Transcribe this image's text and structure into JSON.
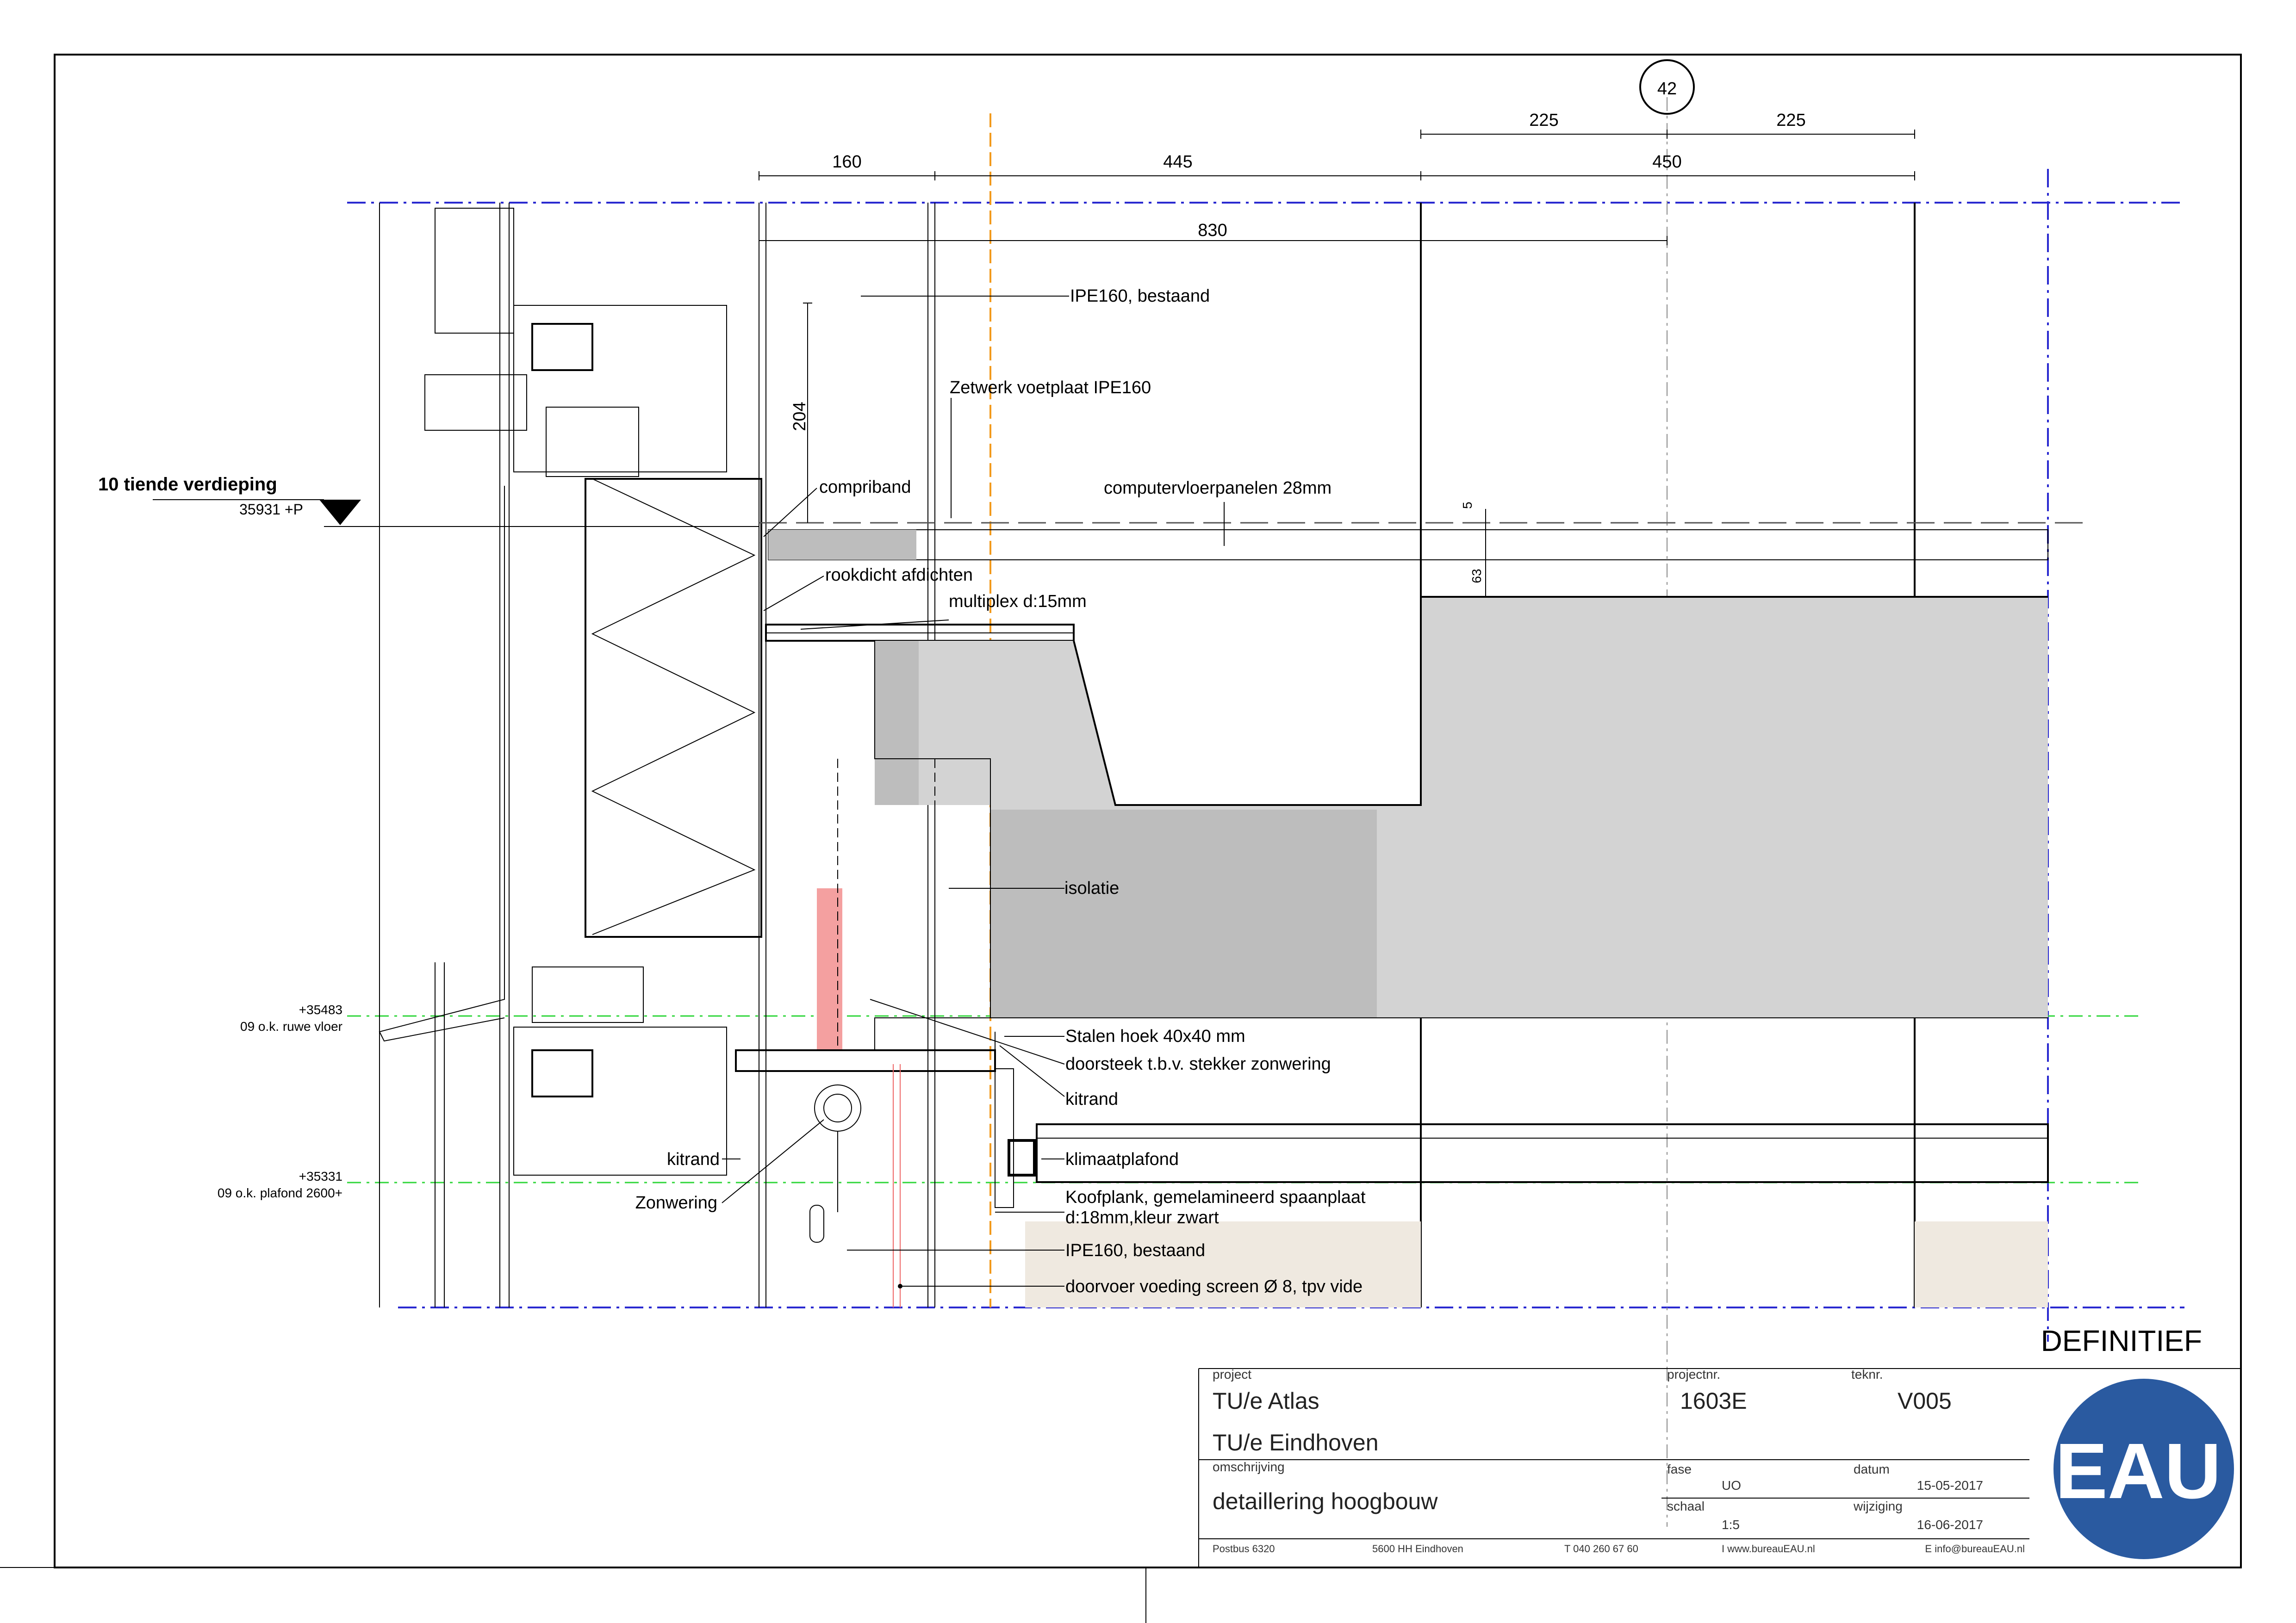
{
  "grid_marker": "42",
  "dimensions": {
    "d160": "160",
    "d445": "445",
    "d450": "450",
    "d225a": "225",
    "d225b": "225",
    "d830": "830",
    "d204": "204",
    "d5": "5",
    "d63": "63"
  },
  "levels": {
    "floor10_name": "10 tiende verdieping",
    "floor10_value": "35931 +P",
    "rough_floor_value": "+35483",
    "rough_floor_name": "09 o.k. ruwe vloer",
    "ceiling_value": "+35331",
    "ceiling_name": "09 o.k. plafond 2600+"
  },
  "labels": {
    "ipe_top": "IPE160, bestaand",
    "zetwerk": "Zetwerk voetplaat IPE160",
    "compriband": "compriband",
    "computervloer": "computervloerpanelen 28mm",
    "rookdicht": "rookdicht afdichten",
    "multiplex": "multiplex d:15mm",
    "isolatie": "isolatie",
    "stalen_hoek": "Stalen hoek 40x40 mm",
    "doorsteek": "doorsteek t.b.v. stekker zonwering",
    "kitrand_right": "kitrand",
    "kitrand_left": "kitrand",
    "klimaatplafond": "klimaatplafond",
    "koofplank_1": "Koofplank, gemelamineerd spaanplaat",
    "koofplank_2": "d:18mm,kleur zwart",
    "zonwering": "Zonwering",
    "ipe_bottom": "IPE160, bestaand",
    "doorvoer": "doorvoer voeding screen Ø 8, tpv vide"
  },
  "status": "DEFINITIEF",
  "title_block": {
    "project_label": "project",
    "project_name": "TU/e Atlas",
    "client": "TU/e Eindhoven",
    "projectnr_label": "projectnr.",
    "projectnr": "1603E",
    "tekenr_label": "teknr.",
    "tekenr": "V005",
    "omschrijving_label": "omschrijving",
    "omschrijving": "detaillering hoogbouw",
    "fase_label": "fase",
    "fase": "UO",
    "datum_label": "datum",
    "datum": "15-05-2017",
    "schaal_label": "schaal",
    "schaal": "1:5",
    "wijziging_label": "wijziging",
    "wijziging": "16-06-2017",
    "footer": {
      "postbus": "Postbus 6320",
      "postcode": "5600 HH Eindhoven",
      "telefoon": "T 040 260 67 60",
      "website": "I www.bureauEAU.nl",
      "email": "E info@bureauEAU.nl"
    },
    "logo_text": "EAU",
    "logo_color": "#2a5aa0"
  },
  "colors": {
    "grid_blue": "#2a2ad0",
    "level_green": "#2fd63a",
    "axis_orange": "#f29a1c",
    "concrete_grey": "#d3d3d3",
    "concrete_dark": "#bdbdbd",
    "highlight_red": "#f4a0a0",
    "beige": "#efe9e0"
  }
}
